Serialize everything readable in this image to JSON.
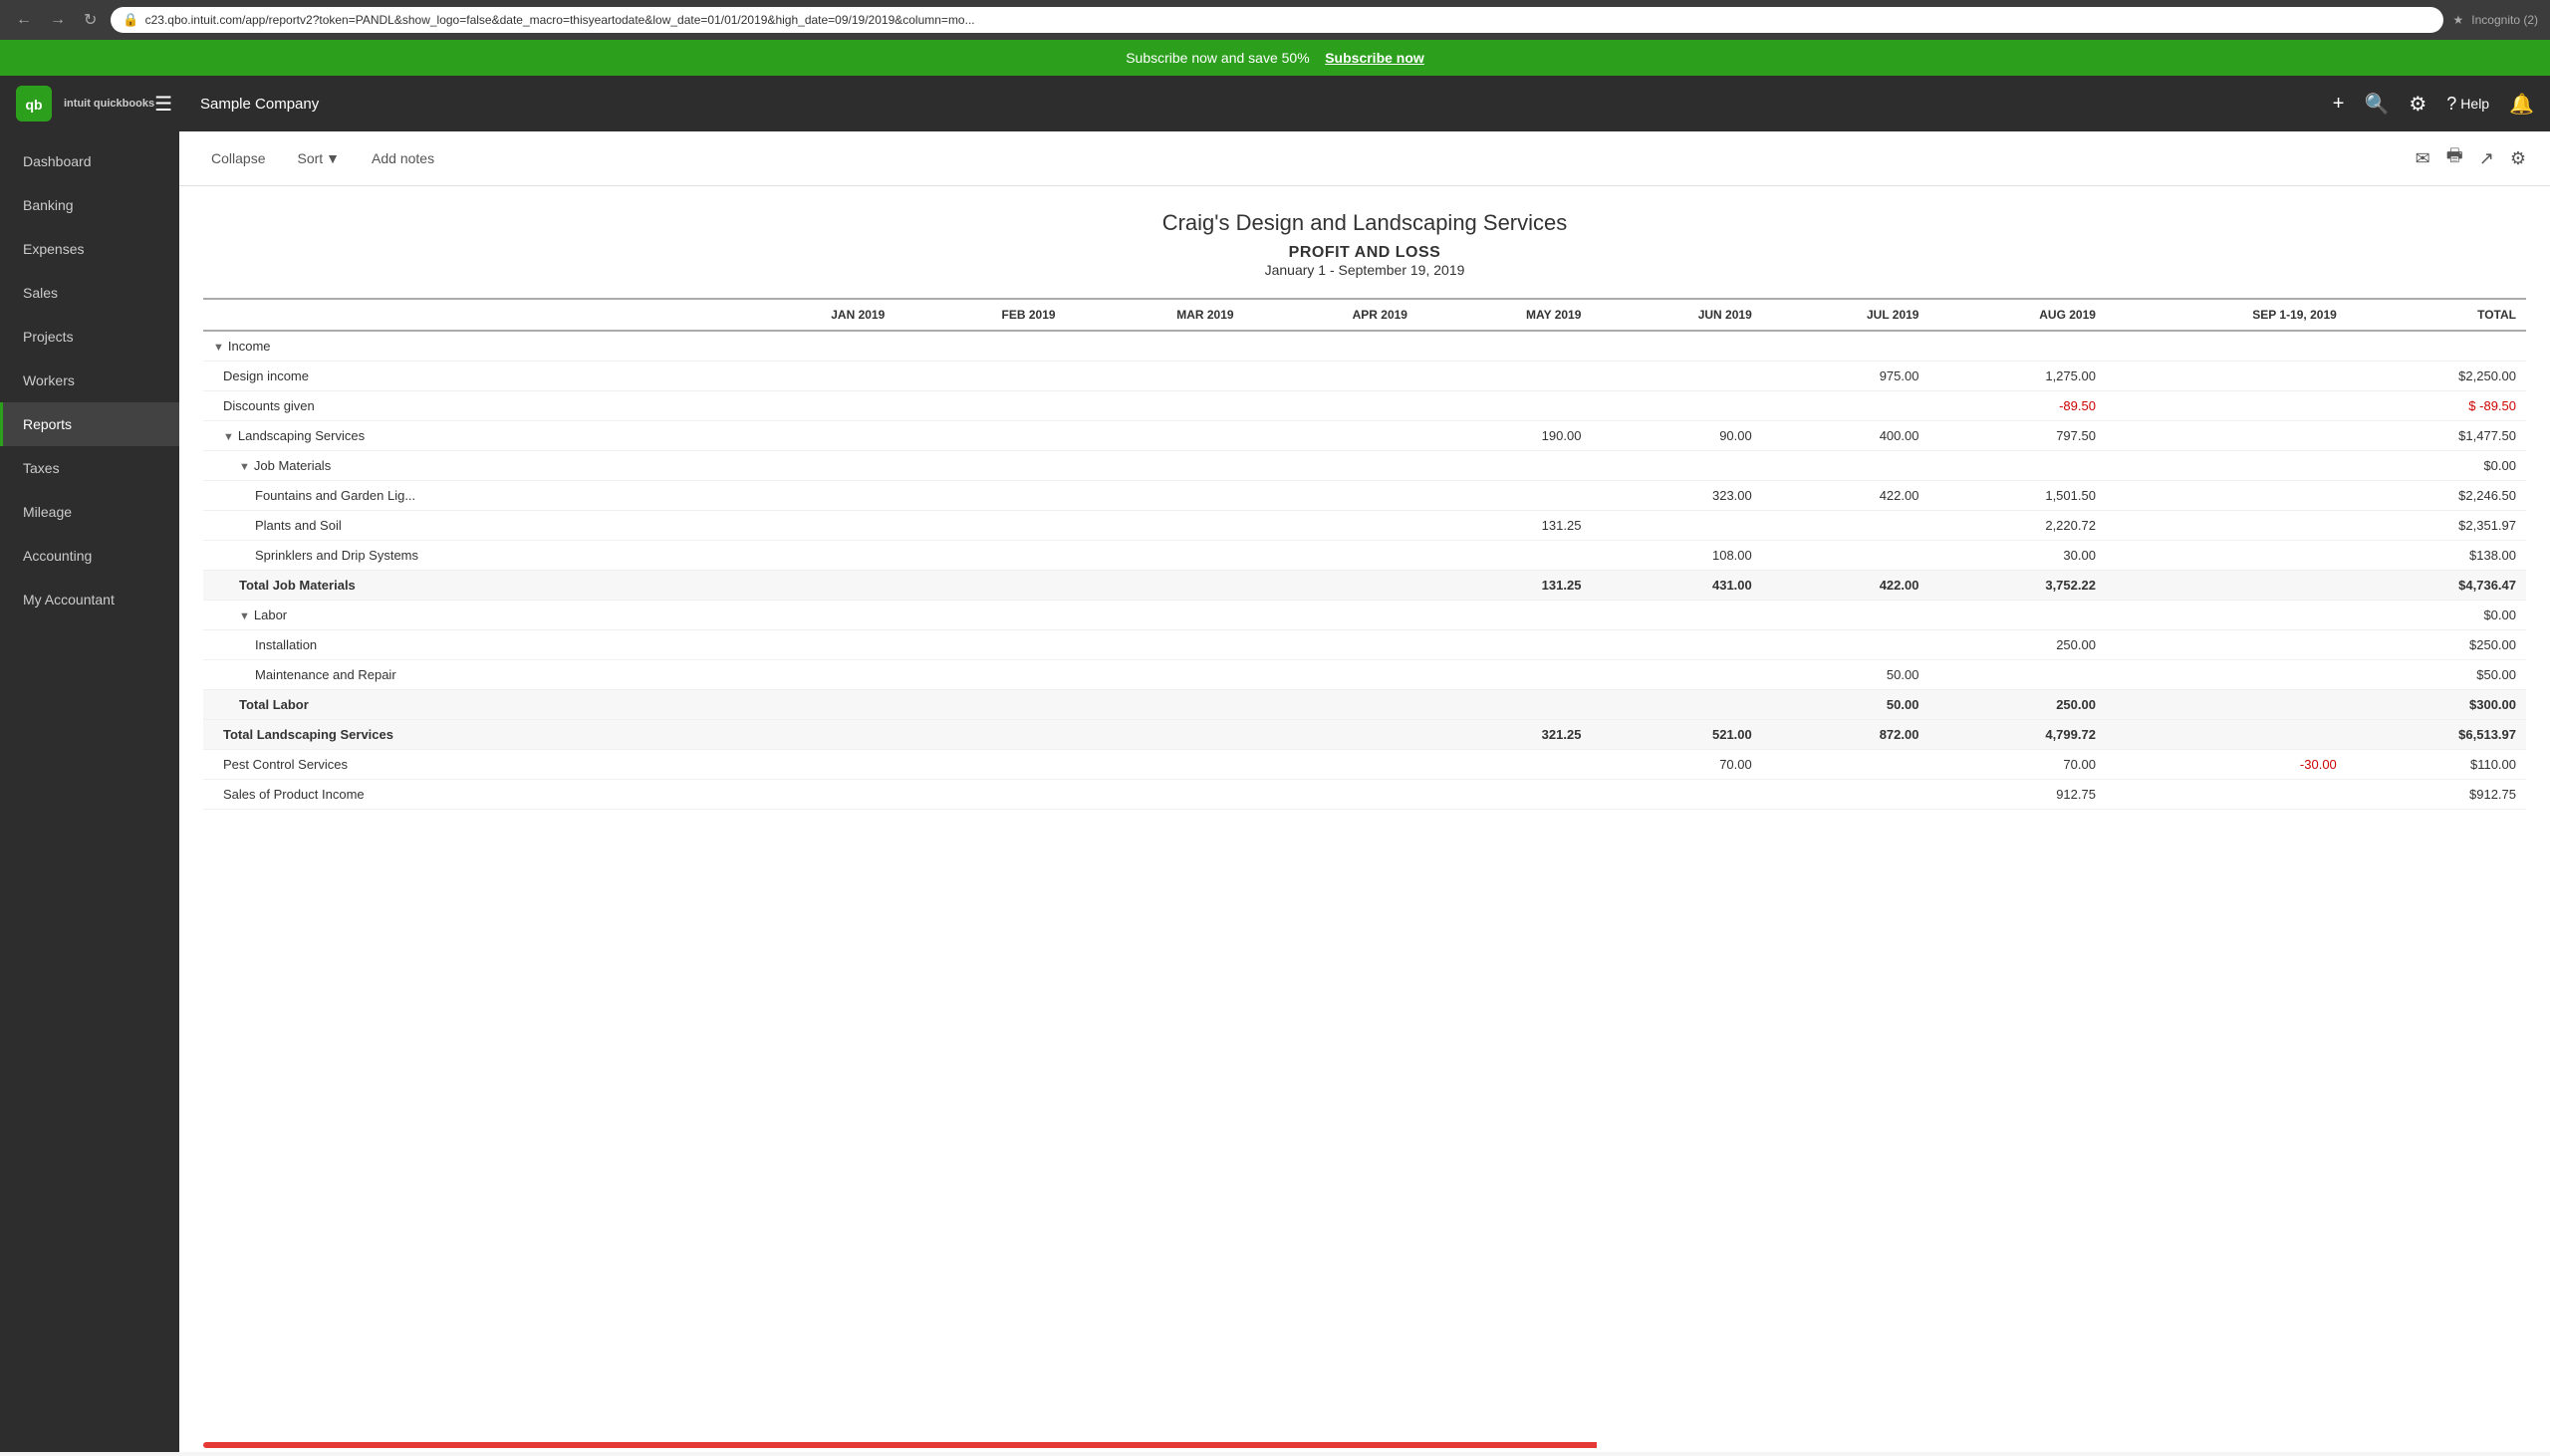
{
  "browser": {
    "url": "c23.qbo.intuit.com/app/reportv2?token=PANDL&show_logo=false&date_macro=thisyeartodate&low_date=01/01/2019&high_date=09/19/2019&column=mo...",
    "incognito": "Incognito (2)"
  },
  "promo": {
    "text": "Subscribe now and save 50%",
    "cta": "Subscribe now"
  },
  "header": {
    "logo_letter": "qb",
    "logo_text": "intuit quickbooks",
    "company": "Sample Company",
    "help": "Help"
  },
  "sidebar": {
    "items": [
      {
        "label": "Dashboard",
        "active": false
      },
      {
        "label": "Banking",
        "active": false
      },
      {
        "label": "Expenses",
        "active": false
      },
      {
        "label": "Sales",
        "active": false
      },
      {
        "label": "Projects",
        "active": false
      },
      {
        "label": "Workers",
        "active": false
      },
      {
        "label": "Reports",
        "active": true
      },
      {
        "label": "Taxes",
        "active": false
      },
      {
        "label": "Mileage",
        "active": false
      },
      {
        "label": "Accounting",
        "active": false
      },
      {
        "label": "My Accountant",
        "active": false
      }
    ]
  },
  "toolbar": {
    "collapse": "Collapse",
    "sort": "Sort",
    "add_notes": "Add notes"
  },
  "report": {
    "company": "Craig's Design and Landscaping Services",
    "report_name": "PROFIT AND LOSS",
    "date_range": "January 1 - September 19, 2019",
    "columns": [
      "JAN 2019",
      "FEB 2019",
      "MAR 2019",
      "APR 2019",
      "MAY 2019",
      "JUN 2019",
      "JUL 2019",
      "AUG 2019",
      "SEP 1-19, 2019",
      "TOTAL"
    ],
    "rows": [
      {
        "type": "section",
        "label": "Income",
        "indent": 0,
        "cols": [
          "",
          "",
          "",
          "",
          "",
          "",
          "",
          "",
          "",
          ""
        ]
      },
      {
        "type": "data",
        "label": "Design income",
        "indent": 1,
        "cols": [
          "",
          "",
          "",
          "",
          "",
          "",
          "975.00",
          "1,275.00",
          "",
          "$2,250.00"
        ]
      },
      {
        "type": "data",
        "label": "Discounts given",
        "indent": 1,
        "cols": [
          "",
          "",
          "",
          "",
          "",
          "",
          "",
          "-89.50",
          "",
          "$ -89.50"
        ]
      },
      {
        "type": "section",
        "label": "Landscaping Services",
        "indent": 1,
        "cols": [
          "",
          "",
          "",
          "",
          "190.00",
          "90.00",
          "400.00",
          "797.50",
          "",
          "$1,477.50"
        ]
      },
      {
        "type": "section",
        "label": "Job Materials",
        "indent": 2,
        "cols": [
          "",
          "",
          "",
          "",
          "",
          "",
          "",
          "",
          "",
          "$0.00"
        ]
      },
      {
        "type": "data",
        "label": "Fountains and Garden Lig...",
        "indent": 3,
        "cols": [
          "",
          "",
          "",
          "",
          "",
          "323.00",
          "422.00",
          "1,501.50",
          "",
          "$2,246.50"
        ]
      },
      {
        "type": "data",
        "label": "Plants and Soil",
        "indent": 3,
        "cols": [
          "",
          "",
          "",
          "",
          "131.25",
          "",
          "",
          "2,220.72",
          "",
          "$2,351.97"
        ]
      },
      {
        "type": "data",
        "label": "Sprinklers and Drip Systems",
        "indent": 3,
        "cols": [
          "",
          "",
          "",
          "",
          "",
          "108.00",
          "",
          "30.00",
          "",
          "$138.00"
        ]
      },
      {
        "type": "total",
        "label": "Total Job Materials",
        "indent": 2,
        "cols": [
          "",
          "",
          "",
          "",
          "131.25",
          "431.00",
          "422.00",
          "3,752.22",
          "",
          "$4,736.47"
        ]
      },
      {
        "type": "section",
        "label": "Labor",
        "indent": 2,
        "cols": [
          "",
          "",
          "",
          "",
          "",
          "",
          "",
          "",
          "",
          "$0.00"
        ]
      },
      {
        "type": "data",
        "label": "Installation",
        "indent": 3,
        "cols": [
          "",
          "",
          "",
          "",
          "",
          "",
          "",
          "250.00",
          "",
          "$250.00"
        ]
      },
      {
        "type": "data",
        "label": "Maintenance and Repair",
        "indent": 3,
        "cols": [
          "",
          "",
          "",
          "",
          "",
          "",
          "50.00",
          "",
          "",
          "$50.00"
        ]
      },
      {
        "type": "total",
        "label": "Total Labor",
        "indent": 2,
        "cols": [
          "",
          "",
          "",
          "",
          "",
          "",
          "50.00",
          "250.00",
          "",
          "$300.00"
        ]
      },
      {
        "type": "total",
        "label": "Total Landscaping Services",
        "indent": 1,
        "cols": [
          "",
          "",
          "",
          "",
          "321.25",
          "521.00",
          "872.00",
          "4,799.72",
          "",
          "$6,513.97"
        ]
      },
      {
        "type": "data",
        "label": "Pest Control Services",
        "indent": 1,
        "cols": [
          "",
          "",
          "",
          "",
          "",
          "70.00",
          "",
          "70.00",
          "-30.00",
          "$110.00"
        ]
      },
      {
        "type": "data",
        "label": "Sales of Product Income",
        "indent": 1,
        "cols": [
          "",
          "",
          "",
          "",
          "",
          "",
          "",
          "912.75",
          "",
          "$912.75"
        ]
      }
    ]
  }
}
